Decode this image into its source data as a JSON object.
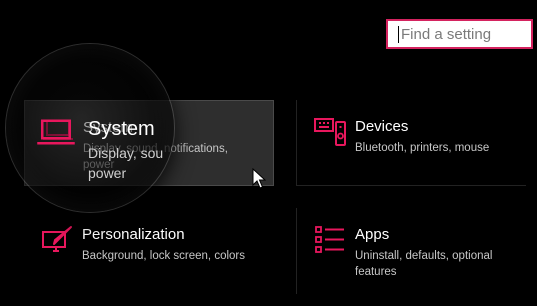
{
  "search": {
    "placeholder": "Find a setting"
  },
  "tiles": [
    {
      "id": "system",
      "title": "System",
      "description": "Display, sound, notifications, power",
      "icon": "laptop-icon"
    },
    {
      "id": "devices",
      "title": "Devices",
      "description": "Bluetooth, printers, mouse",
      "icon": "devices-icon"
    },
    {
      "id": "personalization",
      "title": "Personalization",
      "description": "Background, lock screen, colors",
      "icon": "personalization-icon"
    },
    {
      "id": "apps",
      "title": "Apps",
      "description": "Uninstall, defaults, optional features",
      "icon": "apps-list-icon"
    }
  ],
  "magnifier": {
    "title": "System",
    "description": "Display, sou power"
  },
  "colors": {
    "accent": "#e8175d",
    "background": "#000000",
    "tile_hover": "#2e2e2e"
  }
}
